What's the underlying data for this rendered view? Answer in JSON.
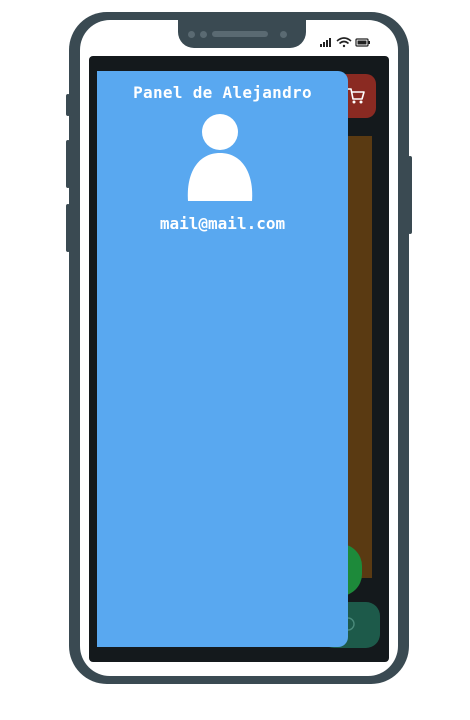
{
  "drawer": {
    "title": "Panel de Alejandro",
    "email": "mail@mail.com",
    "avatar_icon": "user-avatar-icon"
  },
  "app": {
    "cart_icon": "shopping-cart-icon",
    "bottom_nav_icon": "circle-icon"
  },
  "colors": {
    "drawer_background": "#59a8f0",
    "cart_button": "#8a2a22",
    "content_panel": "#5a3a12",
    "fab_button": "#1d8a3a",
    "bottom_nav": "#1d5a4a",
    "phone_body": "#3a4a52"
  }
}
